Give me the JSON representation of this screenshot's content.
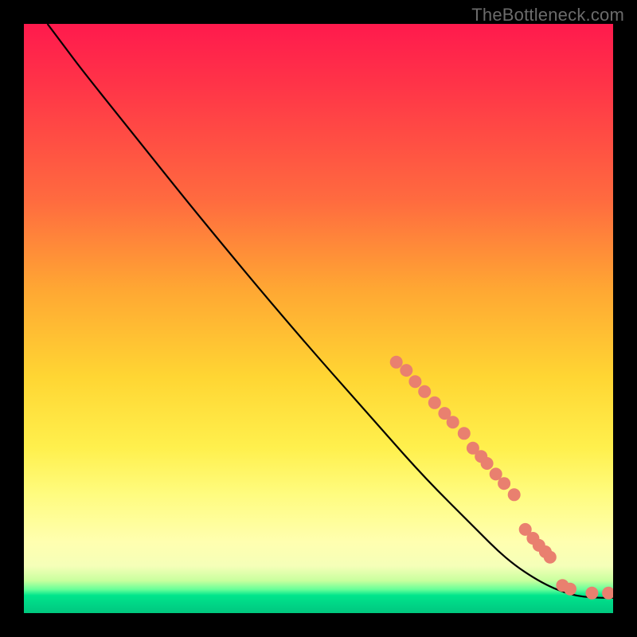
{
  "watermark": "TheBottleneck.com",
  "colors": {
    "marker": "#e9806f",
    "curve": "#000000",
    "frame": "#000000"
  },
  "chart_data": {
    "type": "line",
    "title": "",
    "xlabel": "",
    "ylabel": "",
    "xlim": [
      0,
      100
    ],
    "ylim": [
      0,
      100
    ],
    "grid": false,
    "note": "No axes or tick labels are rendered; values below are read off the 740×740 plot area as percentages (0–100 on both axes, y=0 at bottom).",
    "series": [
      {
        "name": "curve",
        "type": "line",
        "points_xy": [
          [
            4,
            100
          ],
          [
            7,
            96
          ],
          [
            10,
            92
          ],
          [
            18,
            82
          ],
          [
            30,
            67
          ],
          [
            45,
            49
          ],
          [
            60,
            32
          ],
          [
            68,
            23
          ],
          [
            76,
            15
          ],
          [
            82,
            9
          ],
          [
            88,
            5
          ],
          [
            93,
            3
          ],
          [
            97,
            2.6
          ],
          [
            100,
            2.6
          ]
        ]
      },
      {
        "name": "highlighted-markers",
        "type": "scatter",
        "points_xy": [
          [
            63.2,
            42.6
          ],
          [
            64.9,
            41.2
          ],
          [
            66.4,
            39.3
          ],
          [
            68.0,
            37.6
          ],
          [
            69.7,
            35.7
          ],
          [
            71.4,
            33.9
          ],
          [
            72.8,
            32.4
          ],
          [
            74.7,
            30.5
          ],
          [
            76.2,
            28.0
          ],
          [
            77.6,
            26.6
          ],
          [
            78.6,
            25.4
          ],
          [
            80.1,
            23.6
          ],
          [
            81.5,
            22.0
          ],
          [
            83.2,
            20.1
          ],
          [
            85.1,
            14.2
          ],
          [
            86.4,
            12.7
          ],
          [
            87.4,
            11.5
          ],
          [
            88.5,
            10.4
          ],
          [
            89.3,
            9.5
          ],
          [
            91.4,
            4.7
          ],
          [
            92.7,
            4.1
          ],
          [
            96.4,
            3.4
          ],
          [
            99.2,
            3.4
          ]
        ]
      }
    ]
  }
}
